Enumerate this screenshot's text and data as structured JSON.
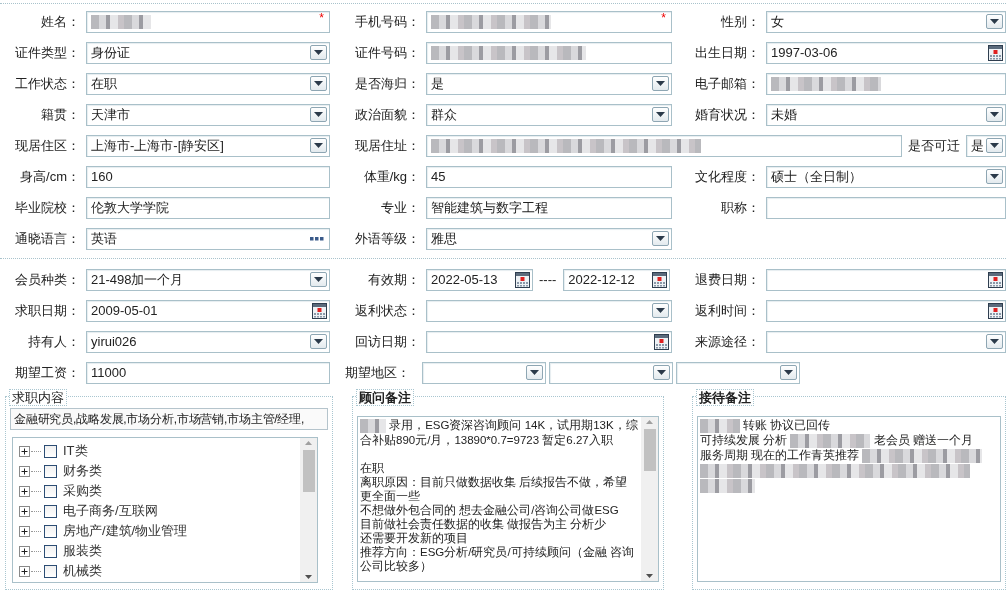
{
  "form_top": {
    "rows": [
      {
        "fields": [
          {
            "label": "姓名：",
            "kind": "text",
            "redacted": true,
            "required_mark": "*"
          },
          {
            "label": "手机号码：",
            "kind": "text",
            "redacted": true,
            "required_mark": "*"
          },
          {
            "label": "性别：",
            "kind": "select",
            "value": "女"
          }
        ]
      },
      {
        "fields": [
          {
            "label": "证件类型：",
            "kind": "select",
            "value": "身份证"
          },
          {
            "label": "证件号码：",
            "kind": "text",
            "redacted": true
          },
          {
            "label": "出生日期：",
            "kind": "date",
            "value": "1997-03-06"
          }
        ]
      },
      {
        "fields": [
          {
            "label": "工作状态：",
            "kind": "select",
            "value": "在职"
          },
          {
            "label": "是否海归：",
            "kind": "select",
            "value": "是"
          },
          {
            "label": "电子邮箱：",
            "kind": "text",
            "redacted": true
          }
        ]
      },
      {
        "fields": [
          {
            "label": "籍贯：",
            "kind": "select",
            "value": "天津市"
          },
          {
            "label": "政治面貌：",
            "kind": "select",
            "value": "群众"
          },
          {
            "label": "婚育状况：",
            "kind": "select",
            "value": "未婚"
          }
        ]
      },
      {
        "fields": [
          {
            "label": "现居住区：",
            "kind": "select",
            "value": "上海市-上海市-[静安区]"
          },
          {
            "label": "现居住址：",
            "kind": "text",
            "redacted": true
          },
          {
            "label": "是否可迁",
            "kind": "select",
            "value": "是"
          }
        ]
      },
      {
        "fields": [
          {
            "label": "身高/cm：",
            "kind": "text",
            "value": "160"
          },
          {
            "label": "体重/kg：",
            "kind": "text",
            "value": "45"
          },
          {
            "label": "文化程度：",
            "kind": "select",
            "value": "硕士（全日制）"
          }
        ]
      },
      {
        "fields": [
          {
            "label": "毕业院校：",
            "kind": "text",
            "value": "伦敦大学学院"
          },
          {
            "label": "专业：",
            "kind": "text",
            "value": "智能建筑与数字工程"
          },
          {
            "label": "职称：",
            "kind": "text"
          }
        ]
      },
      {
        "fields": [
          {
            "label": "通晓语言：",
            "kind": "lookup",
            "value": "英语"
          },
          {
            "label": "外语等级：",
            "kind": "select",
            "value": "雅思"
          }
        ]
      }
    ]
  },
  "form_membership": {
    "rows": [
      {
        "fields": [
          {
            "label": "会员种类：",
            "kind": "select",
            "value": "21-498加一个月"
          },
          {
            "label": "有效期：",
            "kind": "daterange",
            "from": "2022-05-13",
            "separator": "----",
            "to": "2022-12-12"
          },
          {
            "label": "退费日期：",
            "kind": "date"
          }
        ]
      },
      {
        "fields": [
          {
            "label": "求职日期：",
            "kind": "date",
            "value": "2009-05-01"
          },
          {
            "label": "返利状态：",
            "kind": "select"
          },
          {
            "label": "返利时间：",
            "kind": "date"
          }
        ]
      },
      {
        "fields": [
          {
            "label": "持有人：",
            "kind": "select",
            "value": "yirui026"
          },
          {
            "label": "回访日期：",
            "kind": "date"
          },
          {
            "label": "来源途径：",
            "kind": "select"
          }
        ]
      },
      {
        "fields": [
          {
            "label": "期望工资：",
            "kind": "text",
            "value": "11000"
          },
          {
            "label": "期望地区：",
            "kind": "region"
          }
        ]
      }
    ]
  },
  "job_intent": {
    "title": "求职内容",
    "summary": "金融研究员,战略发展,市场分析,市场营销,市场主管/经理,",
    "tree": [
      {
        "label": "IT类",
        "expanded": false,
        "checked": false
      },
      {
        "label": "财务类",
        "expanded": false,
        "checked": false
      },
      {
        "label": "采购类",
        "expanded": false,
        "checked": false
      },
      {
        "label": "电子商务/互联网",
        "expanded": false,
        "checked": false
      },
      {
        "label": "房地产/建筑/物业管理",
        "expanded": false,
        "checked": false
      },
      {
        "label": "服装类",
        "expanded": false,
        "checked": false
      },
      {
        "label": "机械类",
        "expanded": false,
        "checked": false
      }
    ]
  },
  "advisor_notes": {
    "title": "顾问备注",
    "lines": [
      {
        "segments": [
          {
            "kind": "redacted"
          },
          {
            "kind": "text",
            "text": "录用，ESG资深咨询顾问 14K，试用期13K，综合补贴890元/月，13890*0.7=9723  暂定6.27入职"
          }
        ]
      },
      {
        "kind": "blank"
      },
      {
        "segments": [
          {
            "kind": "text",
            "text": "在职"
          }
        ]
      },
      {
        "segments": [
          {
            "kind": "text",
            "text": "离职原因：目前只做数据收集 后续报告不做，希望更全面一些"
          }
        ]
      },
      {
        "segments": [
          {
            "kind": "text",
            "text": "不想做外包合同的 想去金融公司/咨询公司做ESG"
          }
        ]
      },
      {
        "segments": [
          {
            "kind": "text",
            "text": "目前做社会责任数据的收集  做报告为主 分析少"
          }
        ]
      },
      {
        "segments": [
          {
            "kind": "text",
            "text": "还需要开发新的项目"
          }
        ]
      },
      {
        "segments": [
          {
            "kind": "text",
            "text": "推荐方向：ESG分析/研究员/可持续顾问（金融 咨询公司比较多）"
          }
        ]
      }
    ]
  },
  "reception_notes": {
    "title": "接待备注",
    "lines": [
      {
        "segments": [
          {
            "kind": "redacted"
          },
          {
            "kind": "text",
            "text": "转账 协议已回传"
          }
        ]
      },
      {
        "segments": [
          {
            "kind": "text",
            "text": "可持续发展 分析"
          },
          {
            "kind": "redacted"
          },
          {
            "kind": "text",
            "text": "老会员 赠送一个月"
          }
        ]
      },
      {
        "segments": [
          {
            "kind": "text",
            "text": "服务周期  现在的工作青英推荐"
          },
          {
            "kind": "redacted"
          }
        ]
      },
      {
        "segments": [
          {
            "kind": "redacted"
          }
        ]
      },
      {
        "segments": [
          {
            "kind": "redacted"
          }
        ]
      }
    ]
  }
}
